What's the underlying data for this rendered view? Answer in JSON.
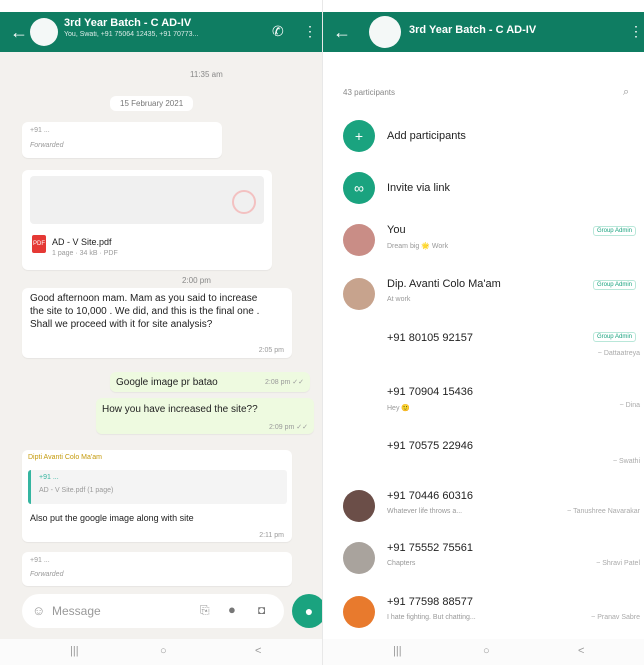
{
  "left": {
    "header": {
      "back_icon": "arrow-left-icon",
      "title": "3rd Year Batch - C AD-IV",
      "subtitle": "You, Swati, +91 75064 12435, +91 70773...",
      "call_icon": "phone-icon",
      "menu_icon": "more-vert-icon"
    },
    "messages": {
      "top_time": "11:35 am",
      "date_chip": "15 February 2021",
      "forwarded_sender": "+91 ...",
      "forwarded_label": "Forwarded",
      "pdf_name": "AD - V Site.pdf",
      "pdf_meta": "1 page · 34 kB · PDF",
      "long_time": "2:00 pm",
      "long_text": "Good afternoon mam. Mam as you said to increase the site to 10,000 . We did, and this is the final one . Shall we proceed with it for site analysis?",
      "long_meta": "2:05 pm",
      "out1_text": "Google image pr batao",
      "out1_meta": "2:08 pm ✓✓",
      "out2_text": "How you have increased the site??",
      "out2_meta": "2:09 pm ✓✓",
      "reply_sender": "Dipti Avanti Colo Ma'am",
      "reply_quote_name": "+91 ...",
      "reply_quote_text": "AD - V Site.pdf (1 page)",
      "reply_text": "Also put the google image along with site",
      "reply_meta": "2:11 pm",
      "bottom_sender": "+91 ...",
      "bottom_forwarded": "Forwarded"
    },
    "input": {
      "placeholder": "Message",
      "emoji_icon": "emoji-icon",
      "attach_icon": "attach-icon",
      "rupee_icon": "rupee-icon",
      "camera_icon": "camera-icon",
      "mic_icon": "mic-icon"
    },
    "nav": {
      "recent": "|||",
      "home": "○",
      "back": "<"
    }
  },
  "right": {
    "header": {
      "back_icon": "arrow-left-icon",
      "title": "3rd Year Batch - C AD-IV",
      "menu_icon": "more-vert-icon"
    },
    "count_label": "43 participants",
    "search_icon": "search-icon",
    "add_participants": "Add participants",
    "invite_link": "Invite via link",
    "participants": [
      {
        "name": "You",
        "status": "Dream big 🌟 Work",
        "badge": "Group Admin",
        "note": ""
      },
      {
        "name": "Dip. Avanti Colo Ma'am",
        "status": "At work",
        "badge": "Group Admin",
        "note": ""
      },
      {
        "name": "+91 80105 92157",
        "status": "",
        "badge": "Group Admin",
        "note": "~ Dattaatreya"
      },
      {
        "name": "+91 70904 15436",
        "status": "Hey 🙂",
        "badge": "",
        "note": "~ Dina"
      },
      {
        "name": "+91 70575 22946",
        "status": "",
        "badge": "",
        "note": "~ Swathi"
      },
      {
        "name": "+91 70446 60316",
        "status": "Whatever life throws a...",
        "badge": "",
        "note": "~ Tanushree Navarakar"
      },
      {
        "name": "+91 75552 75561",
        "status": "Chapters",
        "badge": "",
        "note": "~ Shravi Patel"
      },
      {
        "name": "+91 77598 88577",
        "status": "I hate fighting. But chatting...",
        "badge": "",
        "note": "~ Pranav Sabre"
      }
    ],
    "nav": {
      "recent": "|||",
      "home": "○",
      "back": "<"
    }
  },
  "colors": {
    "header": "#0f7d62",
    "accent": "#1aa37f",
    "chat_bg": "#f3f1ee",
    "outgoing": "#eefae0"
  }
}
